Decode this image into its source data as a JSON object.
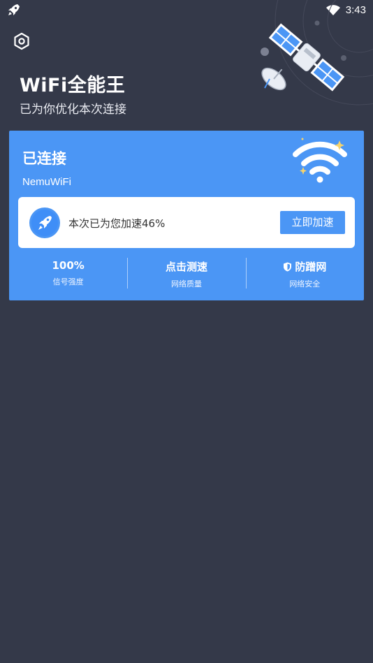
{
  "status_bar": {
    "time": "3:43",
    "left_icon": "rocket-icon",
    "right_icon": "wifi-signal-icon"
  },
  "header": {
    "settings_icon": "settings-icon",
    "title": "WiFi全能王",
    "subtitle": "已为你优化本次连接",
    "illustration": "satellite-icon"
  },
  "card": {
    "status": "已连接",
    "ssid": "NemuWiFi",
    "wifi_icon": "wifi-icon",
    "boost": {
      "icon": "rocket-icon",
      "text": "本次已为您加速46%",
      "button_label": "立即加速"
    },
    "stats": [
      {
        "value": "100%",
        "label": "信号强度"
      },
      {
        "value": "点击测速",
        "label": "网络质量"
      },
      {
        "value": "防蹭网",
        "label": "网络安全",
        "icon": "shield-icon"
      }
    ]
  },
  "colors": {
    "background": "#343949",
    "card": "#4b96f5",
    "boost_box": "#ffffff",
    "accent": "#4b96f5"
  }
}
